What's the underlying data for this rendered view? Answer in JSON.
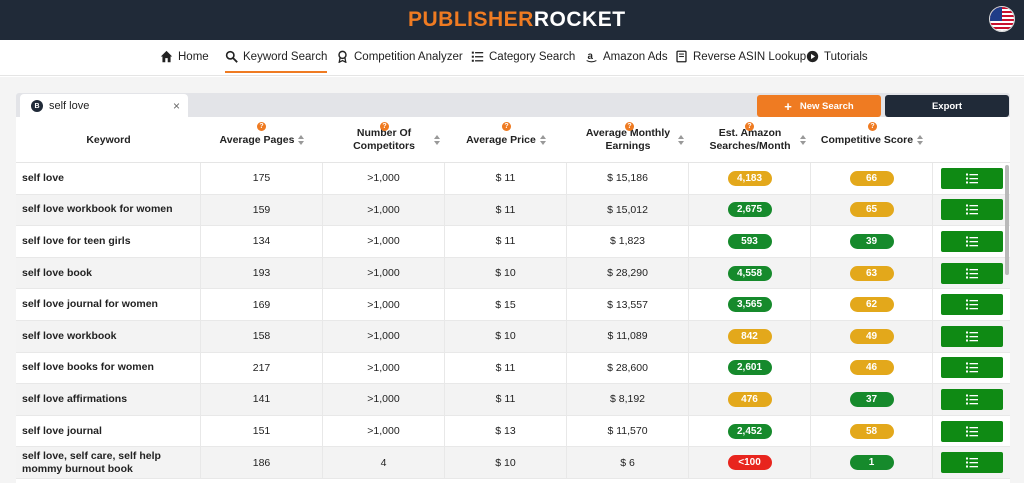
{
  "header": {
    "logo_part1": "PUBLISHER",
    "logo_part2": "ROCKET",
    "flag_icon": "us-flag-icon"
  },
  "nav": [
    {
      "label": "Home",
      "icon": "home-icon"
    },
    {
      "label": "Keyword Search",
      "icon": "search-icon",
      "active": true
    },
    {
      "label": "Competition Analyzer",
      "icon": "award-icon"
    },
    {
      "label": "Category Search",
      "icon": "list-icon"
    },
    {
      "label": "Amazon Ads",
      "icon": "amazon-icon"
    },
    {
      "label": "Reverse ASIN Lookup",
      "icon": "book-icon"
    },
    {
      "label": "Tutorials",
      "icon": "play-icon"
    }
  ],
  "search_tab": {
    "label": "self love",
    "close": "×"
  },
  "toolbar": {
    "new_search": "New Search",
    "new_search_icon": "+",
    "export": "Export"
  },
  "columns": [
    {
      "label": "Keyword",
      "help": false,
      "sort": false
    },
    {
      "label": "Average Pages",
      "help": true,
      "sort": true
    },
    {
      "label": "Number Of Competitors",
      "help": true,
      "sort": true
    },
    {
      "label": "Average Price",
      "help": true,
      "sort": true
    },
    {
      "label": "Average Monthly Earnings",
      "help": true,
      "sort": true
    },
    {
      "label": "Est. Amazon Searches/Month",
      "help": true,
      "sort": true
    },
    {
      "label": "Competitive Score",
      "help": true,
      "sort": true
    }
  ],
  "help_icon_text": "?",
  "rows": [
    {
      "keyword": "self love",
      "pages": "175",
      "competitors": ">1,000",
      "price": "$ 11",
      "earnings": "$ 15,186",
      "searches": "4,183",
      "searches_color": "yellow",
      "score": "66",
      "score_color": "yellow"
    },
    {
      "keyword": "self love workbook for women",
      "pages": "159",
      "competitors": ">1,000",
      "price": "$ 11",
      "earnings": "$ 15,012",
      "searches": "2,675",
      "searches_color": "green",
      "score": "65",
      "score_color": "yellow"
    },
    {
      "keyword": "self love for teen girls",
      "pages": "134",
      "competitors": ">1,000",
      "price": "$ 11",
      "earnings": "$ 1,823",
      "searches": "593",
      "searches_color": "green",
      "score": "39",
      "score_color": "green"
    },
    {
      "keyword": "self love book",
      "pages": "193",
      "competitors": ">1,000",
      "price": "$ 10",
      "earnings": "$ 28,290",
      "searches": "4,558",
      "searches_color": "green",
      "score": "63",
      "score_color": "yellow"
    },
    {
      "keyword": "self love journal for women",
      "pages": "169",
      "competitors": ">1,000",
      "price": "$ 15",
      "earnings": "$ 13,557",
      "searches": "3,565",
      "searches_color": "green",
      "score": "62",
      "score_color": "yellow"
    },
    {
      "keyword": "self love workbook",
      "pages": "158",
      "competitors": ">1,000",
      "price": "$ 10",
      "earnings": "$ 11,089",
      "searches": "842",
      "searches_color": "yellow",
      "score": "49",
      "score_color": "yellow"
    },
    {
      "keyword": "self love books for women",
      "pages": "217",
      "competitors": ">1,000",
      "price": "$ 11",
      "earnings": "$ 28,600",
      "searches": "2,601",
      "searches_color": "green",
      "score": "46",
      "score_color": "yellow"
    },
    {
      "keyword": "self love affirmations",
      "pages": "141",
      "competitors": ">1,000",
      "price": "$ 11",
      "earnings": "$ 8,192",
      "searches": "476",
      "searches_color": "yellow",
      "score": "37",
      "score_color": "green"
    },
    {
      "keyword": "self love journal",
      "pages": "151",
      "competitors": ">1,000",
      "price": "$ 13",
      "earnings": "$ 11,570",
      "searches": "2,452",
      "searches_color": "green",
      "score": "58",
      "score_color": "yellow"
    },
    {
      "keyword": "self love, self care, self help mommy burnout book",
      "pages": "186",
      "competitors": "4",
      "price": "$ 10",
      "earnings": "$ 6",
      "searches": "<100",
      "searches_color": "red",
      "score": "1",
      "score_color": "green"
    }
  ],
  "action_icon": "list-details-icon",
  "colors": {
    "accent": "#ef7b22",
    "navy": "#202a38",
    "green": "#168a2c",
    "yellow": "#e3a81b",
    "red": "#e8251e",
    "action_green": "#0f8a14"
  }
}
